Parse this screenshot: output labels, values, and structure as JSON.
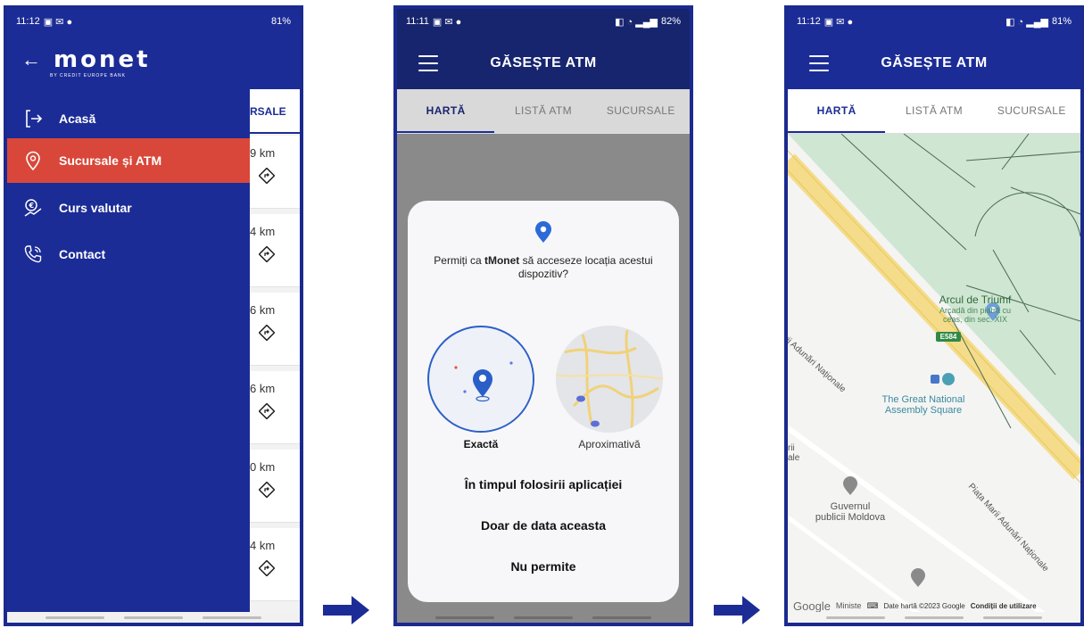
{
  "phone1": {
    "status": {
      "time": "11:12",
      "battery": "81%"
    },
    "logo": {
      "word": "monet",
      "sub": "BY CREDIT EUROPE BANK"
    },
    "menu": [
      {
        "label": "Acasă",
        "icon": "logout-arrow-icon"
      },
      {
        "label": "Sucursale și ATM",
        "icon": "location-pin-icon",
        "active": true
      },
      {
        "label": "Curs valutar",
        "icon": "currency-exchange-icon"
      },
      {
        "label": "Contact",
        "icon": "phone-icon"
      }
    ],
    "under_tab": "RSALE",
    "distances": [
      "9 km",
      "4 km",
      "6 km",
      "6 km",
      "0 km",
      "4 km"
    ]
  },
  "phone2": {
    "status": {
      "time": "11:11",
      "battery": "82%"
    },
    "title": "GĂSEȘTE ATM",
    "tabs": [
      "HARTĂ",
      "LISTĂ ATM",
      "SUCURSALE"
    ],
    "dialog": {
      "question_prefix": "Permiți ca ",
      "app_name": "tMonet",
      "question_suffix": " să acceseze locația acestui dispozitiv?",
      "option_exact": "Exactă",
      "option_approx": "Aproximativă",
      "choices": [
        "În timpul folosirii aplicației",
        "Doar de data aceasta",
        "Nu permite"
      ]
    }
  },
  "phone3": {
    "status": {
      "time": "11:12",
      "battery": "81%"
    },
    "title": "GĂSEȘTE ATM",
    "tabs": [
      "HARTĂ",
      "LISTĂ ATM",
      "SUCURSALE"
    ],
    "map": {
      "arc_title": "Arcul de Triumf",
      "arc_sub1": "Arcadă din piatră cu",
      "arc_sub2": "ceas, din sec. XIX",
      "road_badge": "E584",
      "square1": "The Great National",
      "square2": "Assembly Square",
      "street_left": "Marii Adunări Naționale",
      "street_right": "Piața Marii Adunări Naționale",
      "gov1": "Guvernul",
      "gov2": "publicii Moldova",
      "frag1": "rii",
      "frag2": "ale",
      "ministry": "Ministe",
      "google": "Google",
      "copyright": "Date hartă ©2023 Google",
      "terms": "Condiții de utilizare"
    }
  },
  "colors": {
    "brand_blue": "#1c2c96",
    "active_red": "#d9473a",
    "park_green": "#cfe6d2",
    "road_yellow": "#f5dc8a"
  }
}
